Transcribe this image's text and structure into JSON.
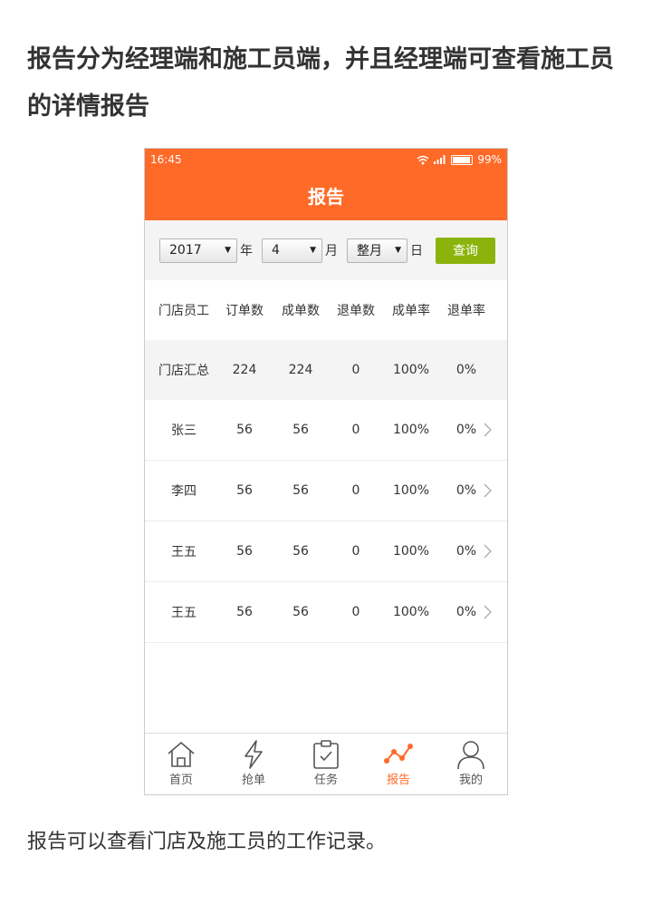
{
  "heading": "报告分为经理端和施工员端，并且经理端可查看施工员的详情报告",
  "status": {
    "time": "16:45",
    "battery": "99%"
  },
  "title": "报告",
  "filter": {
    "year": "2017",
    "year_unit": "年",
    "month": "4",
    "month_unit": "月",
    "day": "整月",
    "day_unit": "日",
    "query_label": "查询"
  },
  "table": {
    "headers": [
      "门店员工",
      "订单数",
      "成单数",
      "退单数",
      "成单率",
      "退单率"
    ],
    "summary": [
      "门店汇总",
      "224",
      "224",
      "0",
      "100%",
      "0%"
    ],
    "rows": [
      [
        "张三",
        "56",
        "56",
        "0",
        "100%",
        "0%"
      ],
      [
        "李四",
        "56",
        "56",
        "0",
        "100%",
        "0%"
      ],
      [
        "王五",
        "56",
        "56",
        "0",
        "100%",
        "0%"
      ],
      [
        "王五",
        "56",
        "56",
        "0",
        "100%",
        "0%"
      ]
    ]
  },
  "tabs": [
    {
      "label": "首页",
      "icon": "home-icon"
    },
    {
      "label": "抢单",
      "icon": "lightning-icon"
    },
    {
      "label": "任务",
      "icon": "clipboard-check-icon"
    },
    {
      "label": "报告",
      "icon": "chart-line-icon",
      "active": true
    },
    {
      "label": "我的",
      "icon": "user-icon"
    }
  ],
  "colors": {
    "brand": "#ff6a28",
    "query_button": "#8ab40b",
    "summary_bg": "#f4f4f4"
  },
  "footer": "报告可以查看门店及施工员的工作记录。"
}
